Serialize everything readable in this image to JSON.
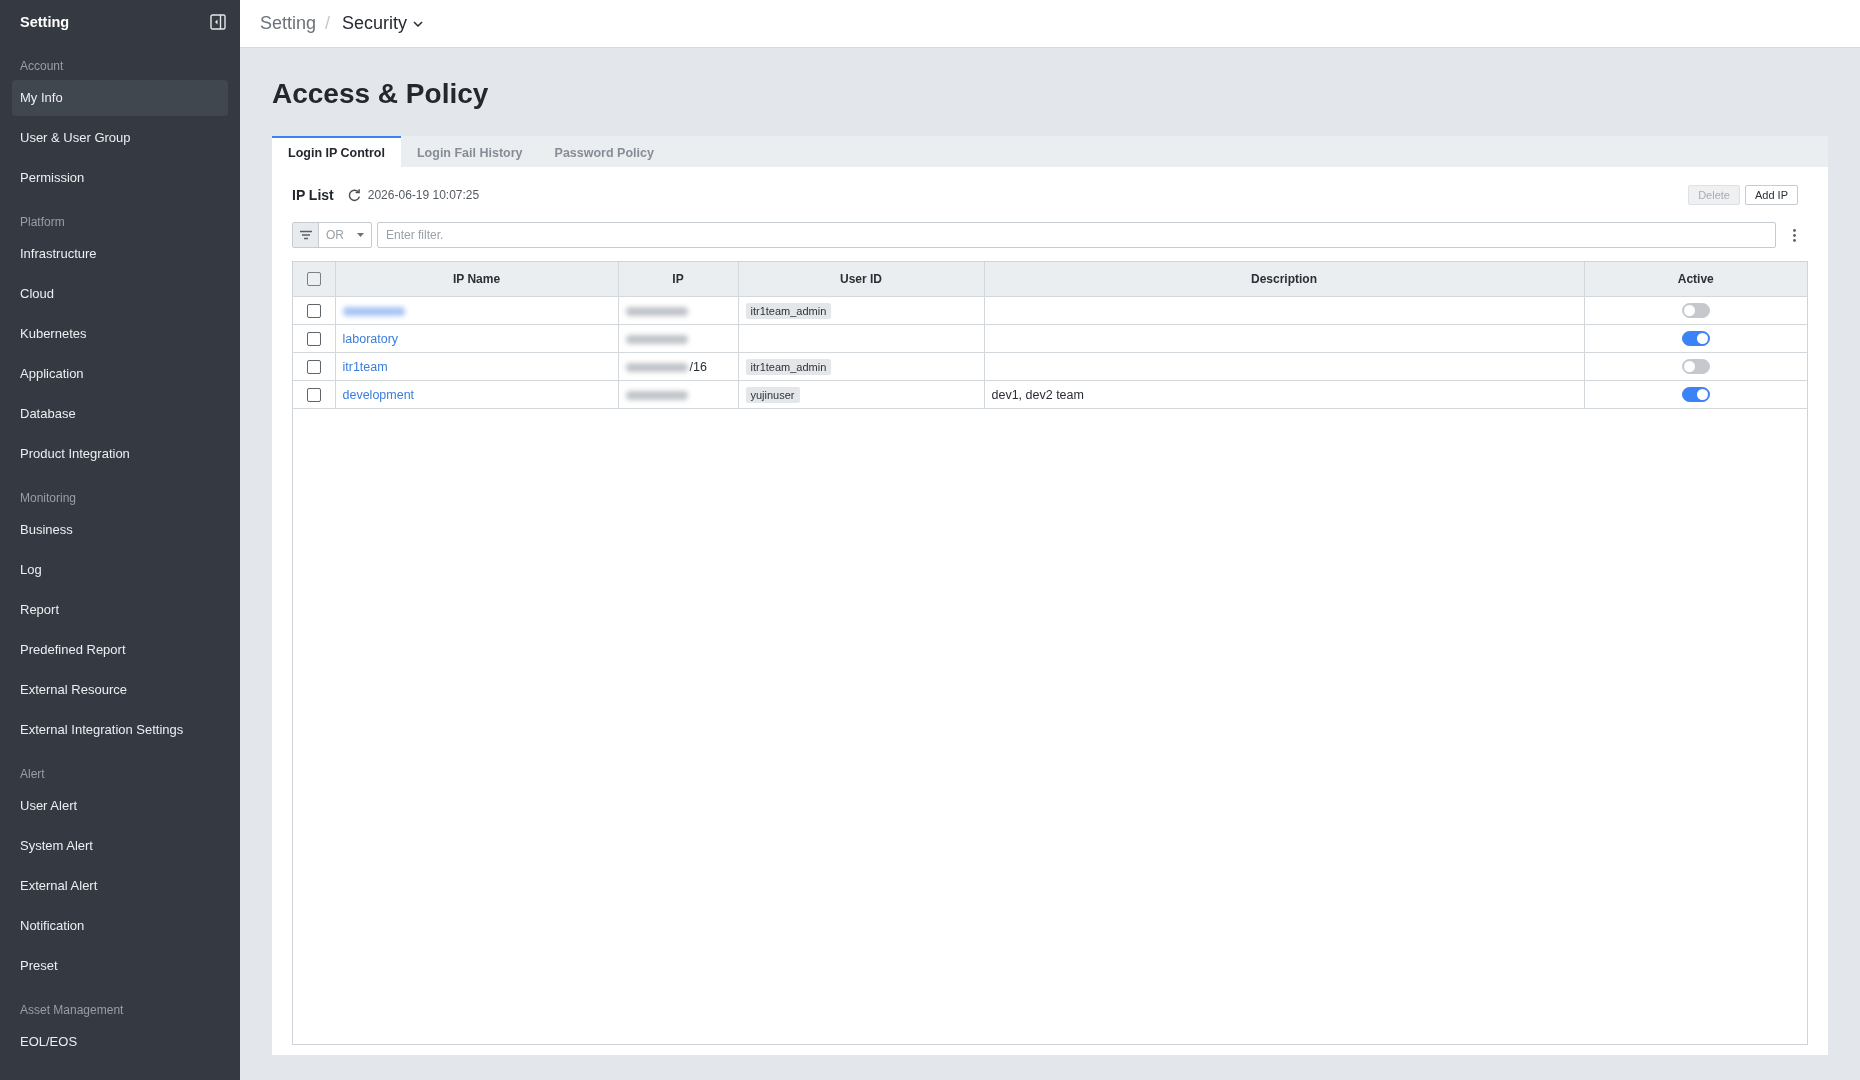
{
  "sidebar": {
    "title": "Setting",
    "sections": [
      {
        "heading": "Account",
        "items": [
          {
            "label": "My Info",
            "selected": true
          },
          {
            "label": "User & User Group",
            "selected": false
          },
          {
            "label": "Permission",
            "selected": false
          }
        ]
      },
      {
        "heading": "Platform",
        "items": [
          {
            "label": "Infrastructure",
            "selected": false
          },
          {
            "label": "Cloud",
            "selected": false
          },
          {
            "label": "Kubernetes",
            "selected": false
          },
          {
            "label": "Application",
            "selected": false
          },
          {
            "label": "Database",
            "selected": false
          },
          {
            "label": "Product Integration",
            "selected": false
          }
        ]
      },
      {
        "heading": "Monitoring",
        "items": [
          {
            "label": "Business",
            "selected": false
          },
          {
            "label": "Log",
            "selected": false
          },
          {
            "label": "Report",
            "selected": false
          },
          {
            "label": "Predefined Report",
            "selected": false
          },
          {
            "label": "External Resource",
            "selected": false
          },
          {
            "label": "External Integration Settings",
            "selected": false
          }
        ]
      },
      {
        "heading": "Alert",
        "items": [
          {
            "label": "User Alert",
            "selected": false
          },
          {
            "label": "System Alert",
            "selected": false
          },
          {
            "label": "External Alert",
            "selected": false
          },
          {
            "label": "Notification",
            "selected": false
          },
          {
            "label": "Preset",
            "selected": false
          }
        ]
      },
      {
        "heading": "Asset Management",
        "items": [
          {
            "label": "EOL/EOS",
            "selected": false
          }
        ]
      }
    ]
  },
  "breadcrumb": {
    "separator": "/",
    "items": [
      {
        "label": "Setting",
        "current": false
      },
      {
        "label": "Security",
        "current": true
      }
    ]
  },
  "page": {
    "title": "Access & Policy"
  },
  "tabs": [
    {
      "label": "Login IP Control",
      "selected": true
    },
    {
      "label": "Login Fail History",
      "selected": false
    },
    {
      "label": "Password Policy",
      "selected": false
    }
  ],
  "ip_list": {
    "title": "IP List",
    "updated": "2026-06-19 10:07:25",
    "buttons": [
      {
        "label": "Delete",
        "disabled": true
      },
      {
        "label": "Add IP",
        "disabled": false
      }
    ],
    "filter": {
      "operator": "OR",
      "placeholder": "Enter filter."
    },
    "table": {
      "all_checked": false,
      "columns": [
        "IP Name",
        "IP",
        "User ID",
        "Description",
        "Active"
      ],
      "rows": [
        {
          "checked": false,
          "name_blurred": true,
          "ip_blurred": true,
          "user_id": "itr1team_admin",
          "active": false
        },
        {
          "checked": false,
          "name": "laboratory",
          "ip_blurred": true,
          "active": true
        },
        {
          "checked": false,
          "name": "itr1team",
          "ip_blurred": true,
          "ip_suffix": "/16",
          "user_id": "itr1team_admin",
          "active": false
        },
        {
          "checked": false,
          "name": "development",
          "ip_blurred": true,
          "user_id": "yujinuser",
          "description": "dev1, dev2 team",
          "active": true
        }
      ]
    }
  }
}
